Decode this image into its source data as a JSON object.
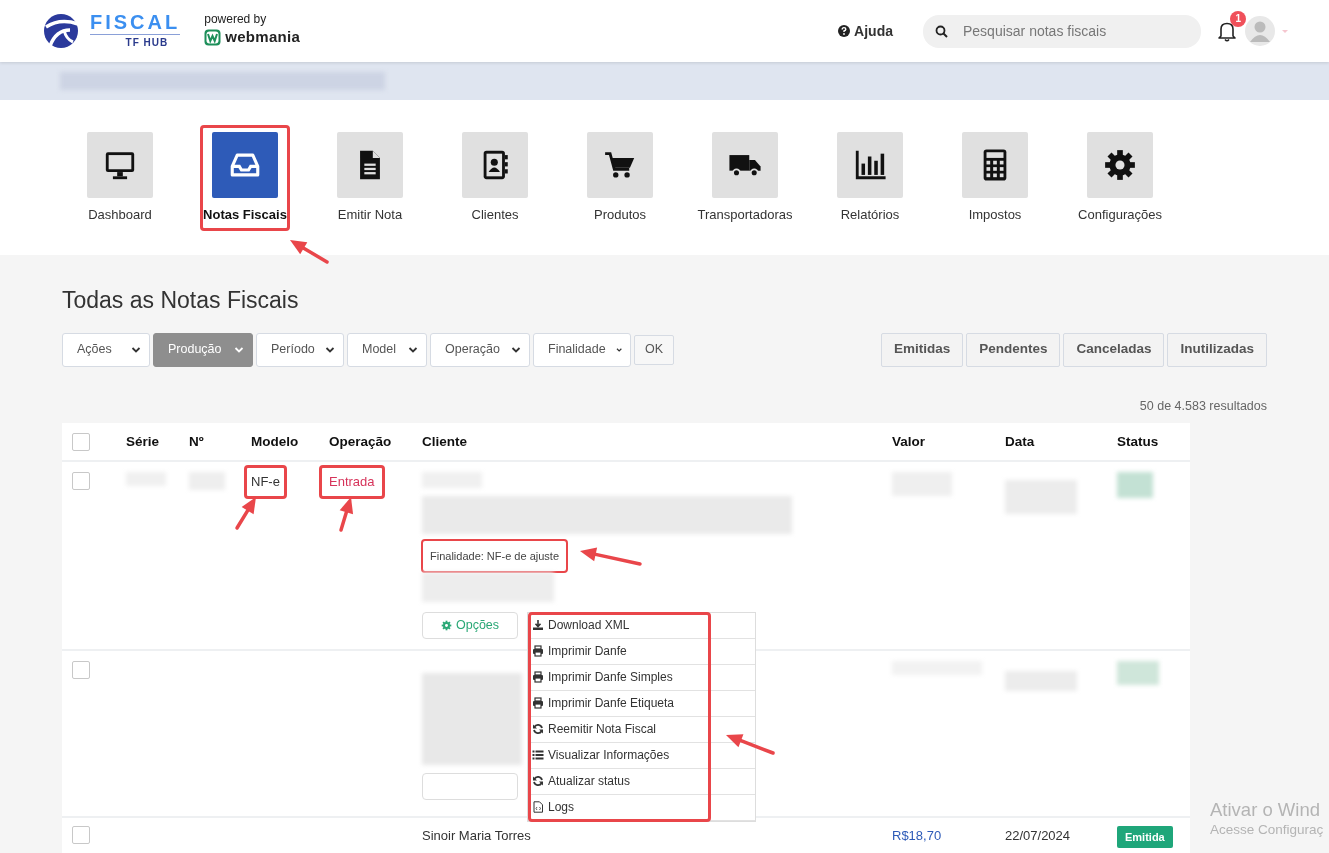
{
  "header": {
    "logo": {
      "name": "FISCAL",
      "sub": "TF HUB"
    },
    "powered_by": "powered by",
    "partner": "webmania",
    "help": "Ajuda",
    "search": {
      "placeholder": "Pesquisar notas fiscais"
    },
    "notifications": {
      "count": "1"
    }
  },
  "modules": [
    {
      "label": "Dashboard",
      "selected": false
    },
    {
      "label": "Notas Fiscais",
      "selected": true
    },
    {
      "label": "Emitir Nota",
      "selected": false
    },
    {
      "label": "Clientes",
      "selected": false
    },
    {
      "label": "Produtos",
      "selected": false
    },
    {
      "label": "Transportadoras",
      "selected": false
    },
    {
      "label": "Relatórios",
      "selected": false
    },
    {
      "label": "Impostos",
      "selected": false
    },
    {
      "label": "Configurações",
      "selected": false
    }
  ],
  "page_title": "Todas as Notas Fiscais",
  "filters": [
    {
      "label": "Ações",
      "active": false
    },
    {
      "label": "Produção",
      "active": true
    },
    {
      "label": "Período",
      "active": false
    },
    {
      "label": "Model",
      "active": false
    },
    {
      "label": "Operação",
      "active": false
    },
    {
      "label": "Finalidade",
      "active": false
    }
  ],
  "ok_button": "OK",
  "status_buttons": [
    "Emitidas",
    "Pendentes",
    "Canceladas",
    "Inutilizadas"
  ],
  "results": "50 de 4.583 resultados",
  "table": {
    "columns": [
      "Série",
      "Nº",
      "Modelo",
      "Operação",
      "Cliente",
      "Valor",
      "Data",
      "Status"
    ],
    "select_all": {
      "checked": false
    },
    "rows": [
      {
        "kind": "detailed",
        "checked": false,
        "modelo": "NF-e",
        "operacao": "Entrada",
        "finalidade": "Finalidade: NF-e de ajuste",
        "options": "Opções"
      },
      {
        "kind": "redacted",
        "checked": false
      },
      {
        "kind": "plain",
        "checked": false,
        "cliente": "Sinoir Maria Torres",
        "valor": "R$18,70",
        "data": "22/07/2024",
        "status": "Emitida"
      }
    ]
  },
  "options_menu": {
    "items": [
      {
        "label": "Download XML"
      },
      {
        "label": "Imprimir Danfe"
      },
      {
        "label": "Imprimir Danfe Simples"
      },
      {
        "label": "Imprimir Danfe Etiqueta"
      },
      {
        "label": "Reemitir Nota Fiscal"
      },
      {
        "label": "Visualizar Informações"
      },
      {
        "label": "Atualizar status"
      },
      {
        "label": "Logs"
      }
    ]
  },
  "os_overlay": {
    "title": "Ativar o Wind",
    "subtitle": "Acesse Configuraç"
  }
}
